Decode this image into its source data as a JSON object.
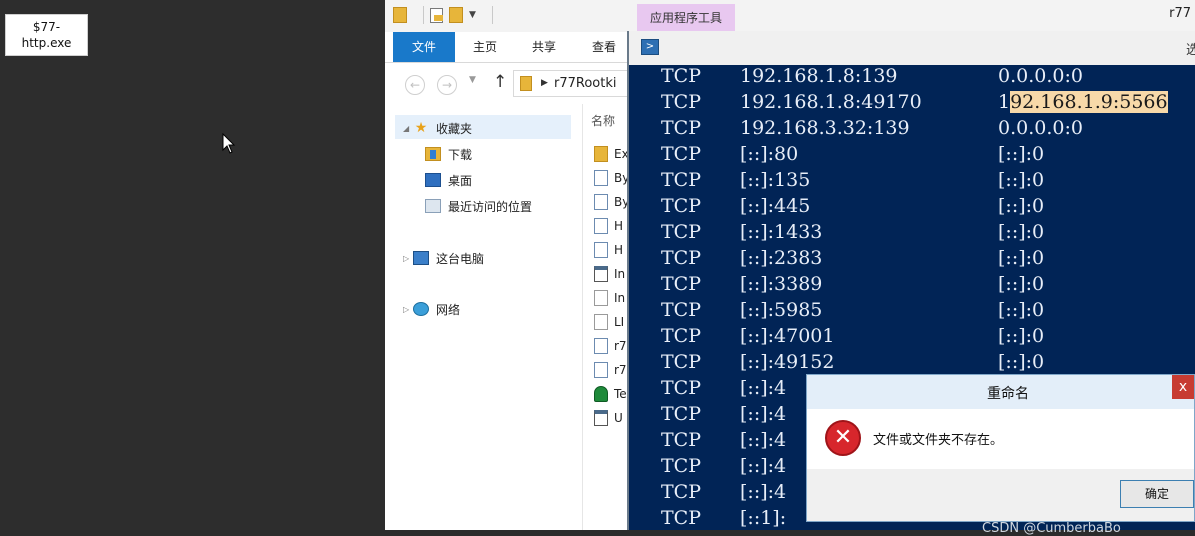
{
  "desktop": {
    "icon_label": "$77-\nhttp.exe"
  },
  "explorer": {
    "contextual_tab": "应用程序工具",
    "window_title": "r77",
    "ribbon_tabs": [
      "文件",
      "主页",
      "共享",
      "查看"
    ],
    "address_path": "r77Rootki",
    "nav_pane": {
      "favorites": "收藏夹",
      "downloads": "下载",
      "desktop": "桌面",
      "recent": "最近访问的位置",
      "this_pc": "这台电脑",
      "network": "网络"
    },
    "column_header": "名称",
    "files": [
      {
        "name": "Ex",
        "icon": "folder-icon"
      },
      {
        "name": "By",
        "icon": "script-icon"
      },
      {
        "name": "By",
        "icon": "script-icon"
      },
      {
        "name": "H",
        "icon": "script-icon"
      },
      {
        "name": "H",
        "icon": "script-icon"
      },
      {
        "name": "In",
        "icon": "exe-icon"
      },
      {
        "name": "In",
        "icon": "doc-icon"
      },
      {
        "name": "LI",
        "icon": "doc-icon"
      },
      {
        "name": "r7",
        "icon": "script-icon"
      },
      {
        "name": "r7",
        "icon": "script-icon"
      },
      {
        "name": "Te",
        "icon": "ghost-icon"
      },
      {
        "name": "U",
        "icon": "exe-icon"
      }
    ]
  },
  "powershell": {
    "title_fragment": "选",
    "lines": [
      {
        "proto": "TCP",
        "local": "192.168.1.8:139",
        "remote": "0.0.0.0:0"
      },
      {
        "proto": "TCP",
        "local": "192.168.1.8:49170",
        "remote": "192.168.1.9:5566"
      },
      {
        "proto": "TCP",
        "local": "192.168.3.32:139",
        "remote": "0.0.0.0:0"
      },
      {
        "proto": "TCP",
        "local": "[::]:80",
        "remote": "[::]:0"
      },
      {
        "proto": "TCP",
        "local": "[::]:135",
        "remote": "[::]:0"
      },
      {
        "proto": "TCP",
        "local": "[::]:445",
        "remote": "[::]:0"
      },
      {
        "proto": "TCP",
        "local": "[::]:1433",
        "remote": "[::]:0"
      },
      {
        "proto": "TCP",
        "local": "[::]:2383",
        "remote": "[::]:0"
      },
      {
        "proto": "TCP",
        "local": "[::]:3389",
        "remote": "[::]:0"
      },
      {
        "proto": "TCP",
        "local": "[::]:5985",
        "remote": "[::]:0"
      },
      {
        "proto": "TCP",
        "local": "[::]:47001",
        "remote": "[::]:0"
      },
      {
        "proto": "TCP",
        "local": "[::]:49152",
        "remote": "[::]:0"
      },
      {
        "proto": "TCP",
        "local": "[::]:4",
        "remote": ""
      },
      {
        "proto": "TCP",
        "local": "[::]:4",
        "remote": ""
      },
      {
        "proto": "TCP",
        "local": "[::]:4",
        "remote": ""
      },
      {
        "proto": "TCP",
        "local": "[::]:4",
        "remote": ""
      },
      {
        "proto": "TCP",
        "local": "[::]:4",
        "remote": ""
      },
      {
        "proto": "TCP",
        "local": "[::1]:",
        "remote": ""
      }
    ],
    "highlight": {
      "prefix": "1",
      "text": "92.168.1.9:5566"
    }
  },
  "dialog": {
    "title": "重命名",
    "close": "x",
    "message": "文件或文件夹不存在。",
    "ok_label": "确定"
  },
  "watermark": "CSDN @CumberbaBo"
}
